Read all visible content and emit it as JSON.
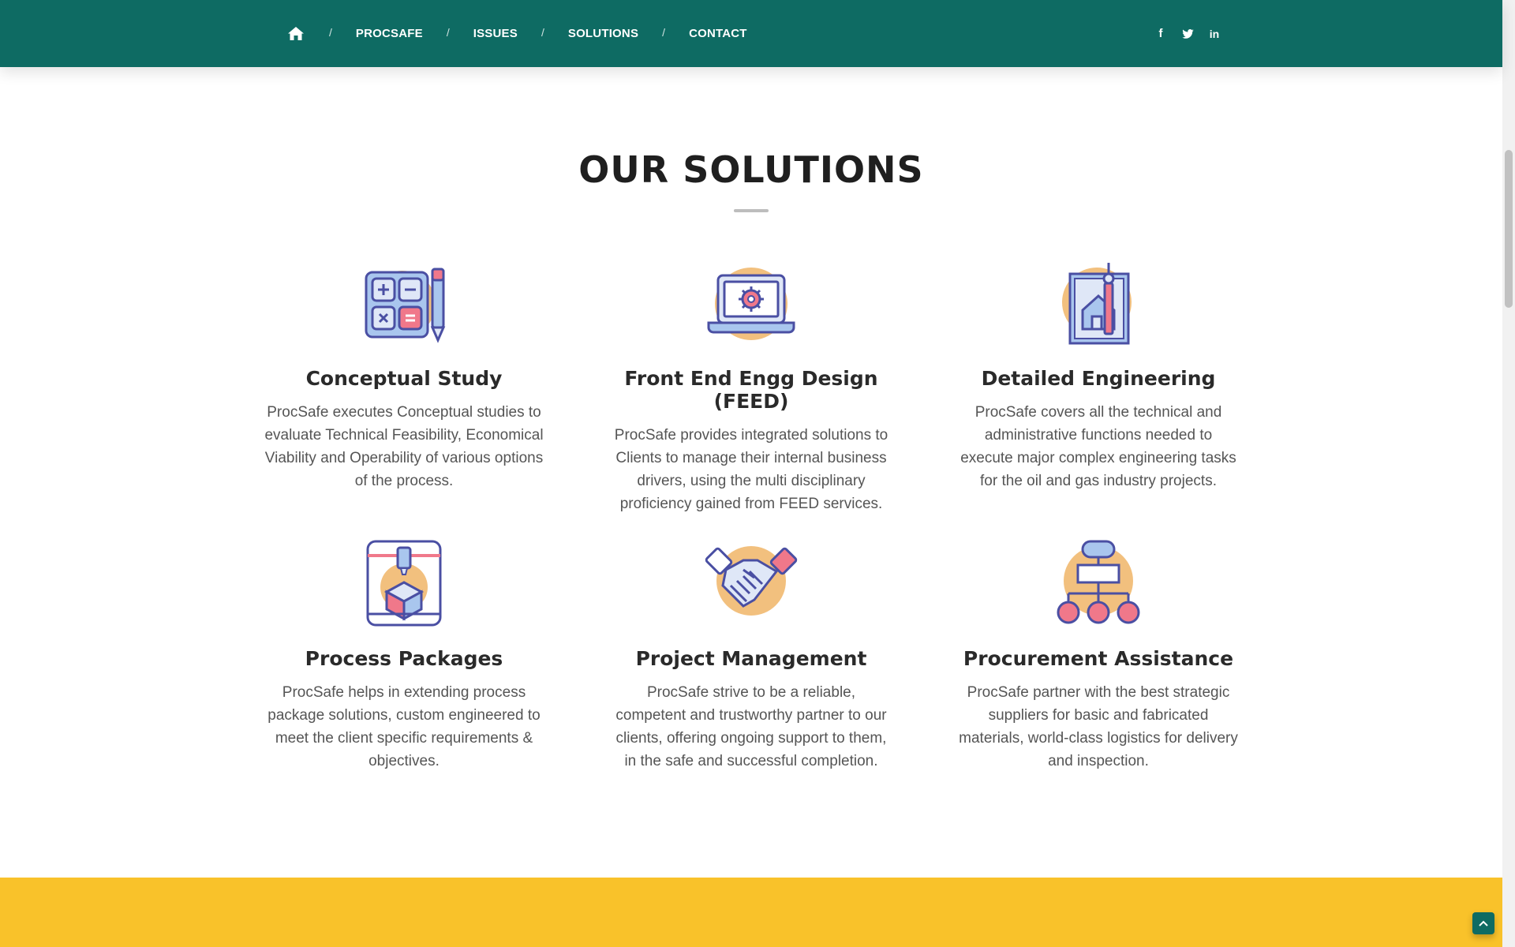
{
  "nav": {
    "home_icon": "home-icon",
    "separator": "/",
    "links": [
      "PROCSAFE",
      "ISSUES",
      "SOLUTIONS",
      "CONTACT"
    ],
    "social": {
      "facebook": "f",
      "twitter_icon": "twitter-icon",
      "linkedin": "in"
    }
  },
  "section": {
    "title": "OUR SOLUTIONS"
  },
  "cards": [
    {
      "icon": "calculator-pencil-icon",
      "title": "Conceptual Study",
      "text": "ProcSafe executes Conceptual studies to evaluate Technical Feasibility, Economical Viability and Operability of various options of the process."
    },
    {
      "icon": "laptop-gear-icon",
      "title": "Front End Engg Design (FEED)",
      "text": "ProcSafe provides integrated solutions to Clients to manage their internal business drivers, using the multi disciplinary proficiency gained from FEED services."
    },
    {
      "icon": "blueprint-compass-icon",
      "title": "Detailed Engineering",
      "text": "ProcSafe covers all the technical and administrative functions needed to execute major complex engineering tasks for the oil and gas industry projects."
    },
    {
      "icon": "package-box-icon",
      "title": "Process Packages",
      "text": "ProcSafe helps in extending process package solutions, custom engineered to meet the client specific requirements & objectives."
    },
    {
      "icon": "handshake-icon",
      "title": "Project Management",
      "text": "ProcSafe strive to be a reliable, competent and trustworthy partner to our clients, offering ongoing support to them, in the safe and successful completion."
    },
    {
      "icon": "org-chart-icon",
      "title": "Procurement Assistance",
      "text": "ProcSafe partner with the best strategic suppliers for basic and fabricated materials, world-class logistics for delivery and inspection."
    }
  ],
  "colors": {
    "nav_bg": "#0e6b63",
    "accent_yellow": "#f9c22a",
    "icon_blue": "#4a4fa3",
    "icon_pink": "#f0788a",
    "icon_orange": "#f2c07e"
  },
  "scroll_to_top_icon": "chevron-up-icon"
}
